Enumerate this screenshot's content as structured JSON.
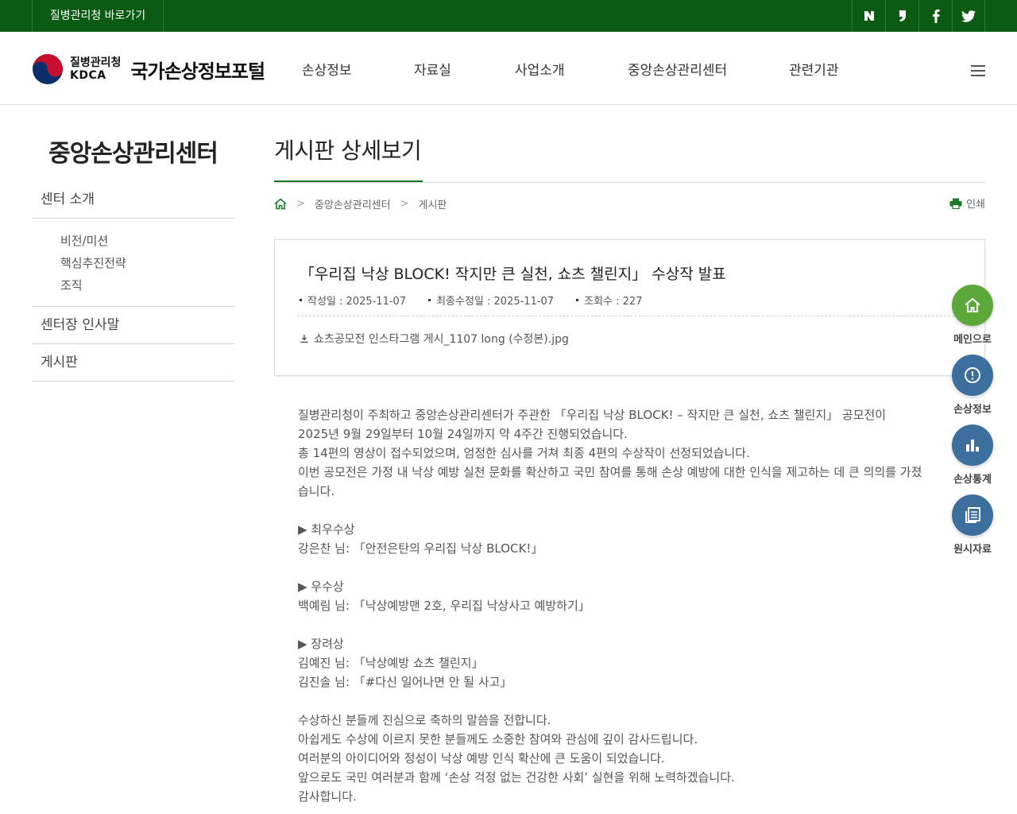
{
  "topbar": {
    "shortcut": "질병관리청 바로가기",
    "social": [
      {
        "icon": "naver-blog-icon",
        "glyph": "N"
      },
      {
        "icon": "naver-post-icon",
        "glyph": "❜"
      },
      {
        "icon": "facebook-icon",
        "glyph": "f"
      },
      {
        "icon": "twitter-icon",
        "glyph": "t"
      }
    ]
  },
  "header": {
    "logo_kdca_ko": "질병관리청",
    "logo_kdca_en": "KDCA",
    "logo_portal": "국가손상정보포털",
    "menu": [
      "손상정보",
      "자료실",
      "사업소개",
      "중앙손상관리센터",
      "관련기관"
    ]
  },
  "lnb": {
    "title": "중앙손상관리센터",
    "items": [
      {
        "label": "센터 소개",
        "sub": [
          "비전/미션",
          "핵심추진전략",
          "조직"
        ]
      },
      {
        "label": "센터장 인사말"
      },
      {
        "label": "게시판"
      }
    ]
  },
  "content": {
    "page_title": "게시판 상세보기",
    "breadcrumb": [
      "중앙손상관리센터",
      "게시판"
    ],
    "print_label": "인쇄",
    "post": {
      "title": "「우리집 낙상 BLOCK! 작지만 큰 실천, 쇼츠 챌린지」 수상작 발표",
      "created": "작성일 : 2025-11-07",
      "modified": "최종수정일 : 2025-11-07",
      "views": "조회수 : 227",
      "attachment": "쇼츠공모전 인스타그램 게시_1107 long (수정본).jpg"
    },
    "body": [
      "질병관리청이 주최하고 중앙손상관리센터가 주관한 「우리집 낙상 BLOCK! – 작지만 큰 실천, 쇼츠 챌린지」 공모전이",
      "2025년 9월 29일부터 10월 24일까지 약 4주간 진행되었습니다.",
      "총 14편의 영상이 접수되었으며, 엄정한 심사를 거쳐 최종 4편의 수상작이 선정되었습니다.",
      "이번 공모전은 가정 내 낙상 예방 실천 문화를 확산하고 국민 참여를 통해 손상 예방에 대한 인식을 제고하는 데 큰 의의를 가졌",
      "습니다.",
      "",
      "▶ 최우수상",
      "강은찬 님: 「안전은탄의 우리집 낙상 BLOCK!」",
      "",
      "▶ 우수상",
      "백예림 님: 「낙상예방맨 2호, 우리집 낙상사고 예방하기」",
      "",
      "▶ 장려상",
      "김예진 님: 「낙상예방 쇼츠 챌린지」",
      "김진솔 님: 「#다신 일어나면 안 될 사고」",
      "",
      "수상하신 분들께 진심으로 축하의 말씀을 전합니다.",
      "아쉽게도 수상에 이르지 못한 분들께도 소중한 참여와 관심에 깊이 감사드립니다.",
      "여러분의 아이디어와 정성이 낙상 예방 인식 확산에 큰 도움이 되었습니다.",
      "앞으로도 국민 여러분과 함께 ‘손상 걱정 없는 건강한 사회’ 실현을 위해 노력하겠습니다.",
      "감사합니다."
    ]
  },
  "quick_menu": [
    {
      "label": "메인으로",
      "icon": "home-icon",
      "color": "#5aa83a"
    },
    {
      "label": "손상정보",
      "icon": "info-icon",
      "color": "#3c6f9e"
    },
    {
      "label": "손상통계",
      "icon": "bar-chart-icon",
      "color": "#3c6f9e"
    },
    {
      "label": "원시자료",
      "icon": "document-icon",
      "color": "#3c6f9e"
    }
  ],
  "colors": {
    "topbar": "#0c5b12",
    "accent_green": "#1a7a23",
    "quick_blue": "#3c6f9e",
    "quick_green": "#5aa83a"
  }
}
